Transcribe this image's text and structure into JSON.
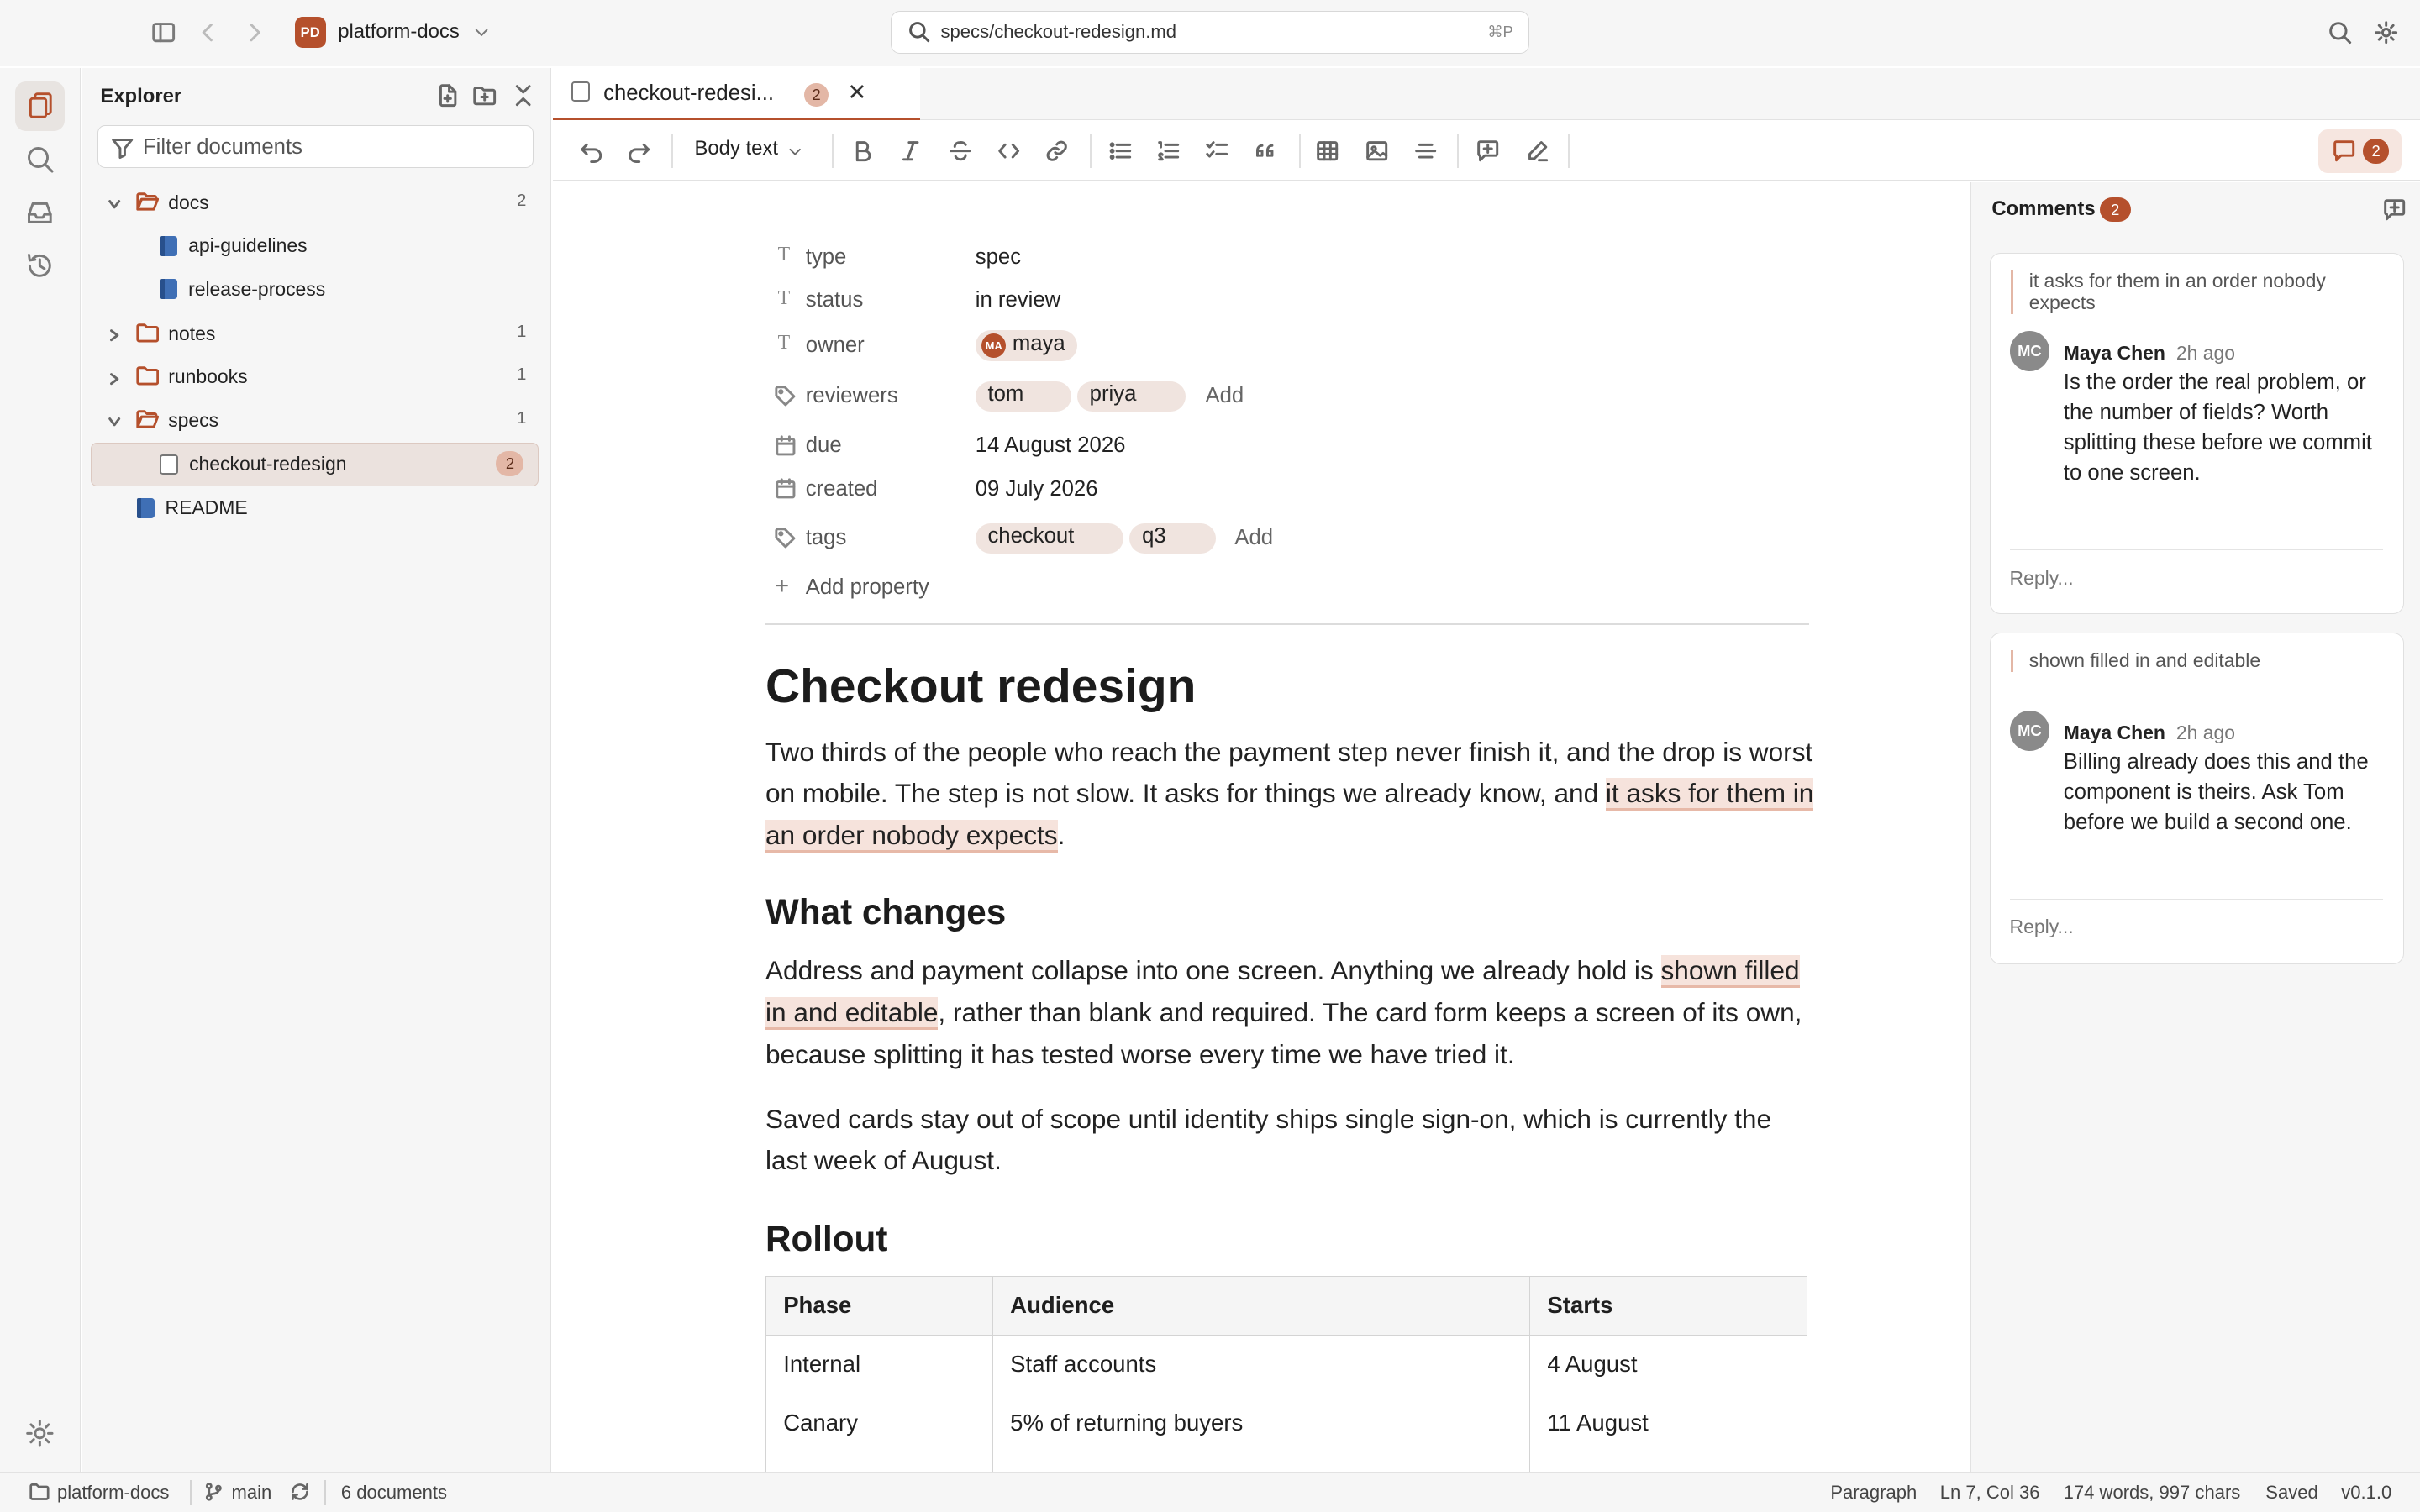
{
  "workspace": {
    "badge": "PD",
    "name": "platform-docs"
  },
  "search": {
    "query": "specs/checkout-redesign.md",
    "shortcut": "⌘P"
  },
  "explorer": {
    "title": "Explorer",
    "filter_placeholder": "Filter documents",
    "tree": [
      {
        "label": "docs",
        "count": "2"
      },
      {
        "label": "api-guidelines"
      },
      {
        "label": "release-process"
      },
      {
        "label": "notes",
        "count": "1"
      },
      {
        "label": "runbooks",
        "count": "1"
      },
      {
        "label": "specs",
        "count": "1"
      },
      {
        "label": "checkout-redesign",
        "count": "2"
      },
      {
        "label": "README"
      }
    ]
  },
  "tab": {
    "label": "checkout-redesi...",
    "count": "2",
    "close": "✕"
  },
  "toolbar": {
    "block_format": "Body text",
    "comment_count": "2"
  },
  "properties": {
    "type": {
      "key": "type",
      "value": "spec"
    },
    "status": {
      "key": "status",
      "value": "in review"
    },
    "owner": {
      "key": "owner",
      "initials": "MA",
      "value": "maya"
    },
    "reviewers": {
      "key": "reviewers",
      "items": [
        "tom",
        "priya"
      ],
      "add": "Add"
    },
    "due": {
      "key": "due",
      "value": "14 August 2026"
    },
    "created": {
      "key": "created",
      "value": "09 July 2026"
    },
    "tags": {
      "key": "tags",
      "items": [
        "checkout",
        "q3"
      ],
      "add": "Add"
    },
    "add_property": "Add property"
  },
  "document": {
    "title": "Checkout redesign",
    "p1_a": "Two thirds of the people who reach the payment step never finish it, and the drop is worst on mobile. The step is not slow. It asks for things we already know, and ",
    "p1_hl": "it asks for them in an order nobody expects",
    "p1_b": ".",
    "h2_changes": "What changes",
    "p2_a": "Address and payment collapse into one screen. Anything we already hold is ",
    "p2_hl": "shown filled in and editable",
    "p2_b": ", rather than blank and required. The card form keeps a screen of its own, because splitting it has tested worse every time we have tried it.",
    "p3": "Saved cards stay out of scope until identity ships single sign-on, which is currently the last week of August.",
    "h2_rollout": "Rollout",
    "table": {
      "headers": [
        "Phase",
        "Audience",
        "Starts"
      ],
      "rows": [
        [
          "Internal",
          "Staff accounts",
          "4 August"
        ],
        [
          "Canary",
          "5% of returning buyers",
          "11 August"
        ]
      ]
    }
  },
  "comments": {
    "title": "Comments",
    "count": "2",
    "threads": [
      {
        "quote": "it asks for them in an order nobody expects",
        "initials": "MC",
        "author": "Maya Chen",
        "time": "2h ago",
        "body": "Is the order the real problem, or the number of fields? Worth splitting these before we commit to one screen.",
        "reply": "Reply..."
      },
      {
        "quote": "shown filled in and editable",
        "initials": "MC",
        "author": "Maya Chen",
        "time": "2h ago",
        "body": "Billing already does this and the component is theirs. Ask Tom before we build a second one.",
        "reply": "Reply..."
      }
    ]
  },
  "statusbar": {
    "workspace": "platform-docs",
    "branch": "main",
    "documents": "6 documents",
    "block": "Paragraph",
    "cursor": "Ln 7, Col 36",
    "stats": "174 words, 997 chars",
    "save_state": "Saved",
    "version": "v0.1.0"
  },
  "colors": {
    "accent": "#b5502c",
    "highlight": "#f6e3dc",
    "chip": "#f0e4df"
  }
}
